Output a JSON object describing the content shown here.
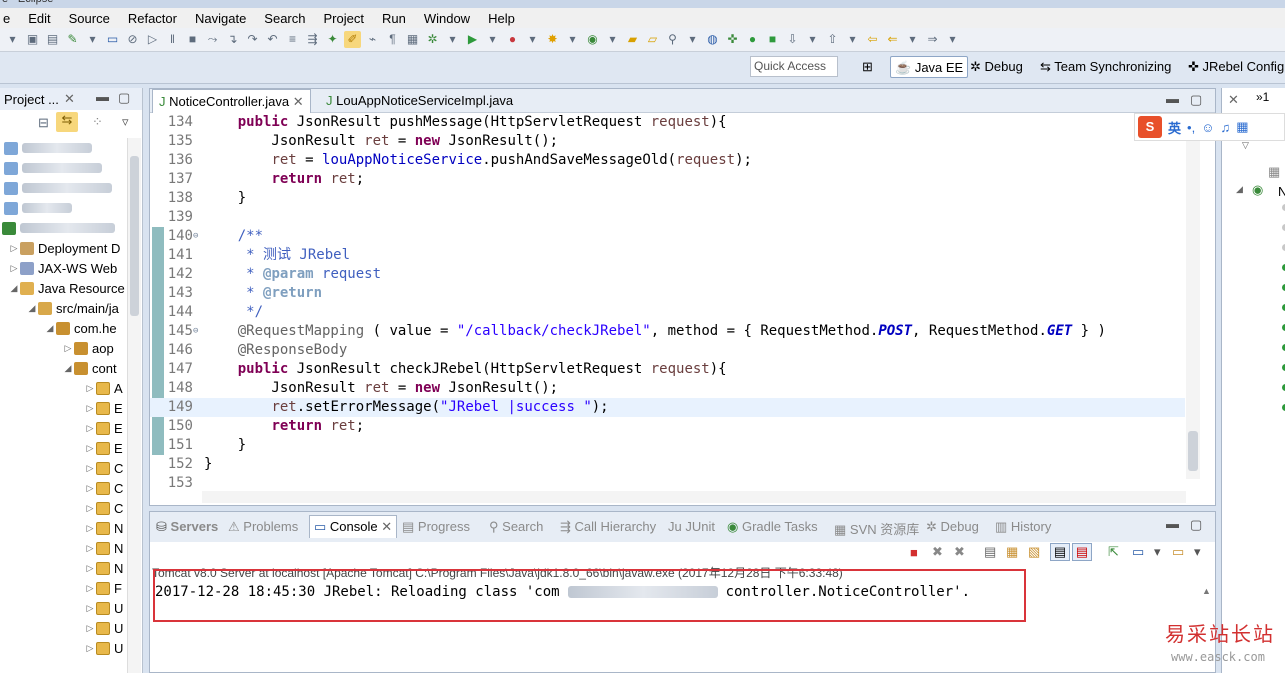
{
  "menu": [
    "Edit",
    "Source",
    "Refactor",
    "Navigate",
    "Search",
    "Project",
    "Run",
    "Window",
    "Help"
  ],
  "quick_access": "Quick Access",
  "perspectives": [
    {
      "label": "Java EE"
    },
    {
      "label": "Debug"
    },
    {
      "label": "Team Synchronizing"
    },
    {
      "label": "JRebel Config"
    }
  ],
  "project_explorer": {
    "title": "Project ...",
    "items": [
      "Deployment D",
      "JAX-WS Web",
      "Java Resource",
      "src/main/ja",
      "com.he",
      "aop",
      "cont"
    ],
    "class_letters": [
      "A",
      "E",
      "E",
      "E",
      "C",
      "C",
      "C",
      "N",
      "N",
      "N",
      "F",
      "U",
      "U",
      "U"
    ]
  },
  "editor": {
    "tabs": [
      "NoticeController.java",
      "LouAppNoticeServiceImpl.java"
    ],
    "line_numbers": [
      "134",
      "135",
      "136",
      "137",
      "138",
      "139",
      "140",
      "141",
      "142",
      "143",
      "144",
      "145",
      "146",
      "147",
      "148",
      "149",
      "150",
      "151",
      "152",
      "153"
    ]
  },
  "bottom_tabs": [
    "Servers",
    "Problems",
    "Console",
    "Progress",
    "Search",
    "Call Hierarchy",
    "JUnit",
    "Gradle Tasks",
    "SVN 资源库",
    "Debug",
    "History"
  ],
  "console": {
    "process": "Tomcat v8.0 Server at localhost [Apache Tomcat] C:\\Program Files\\Java\\jdk1.8.0_66\\bin\\javaw.exe (2017年12月28日 下午6:33:48)",
    "output_prefix": "2017-12-28 18:45:30 JRebel: Reloading class 'com",
    "output_suffix": "controller.NoticeController'."
  },
  "ime": {
    "lang": "英"
  },
  "watermark": {
    "title": "易采站长站",
    "url": "www.easck.com"
  },
  "right_panel": {
    "letters": [
      "c",
      "N"
    ]
  }
}
